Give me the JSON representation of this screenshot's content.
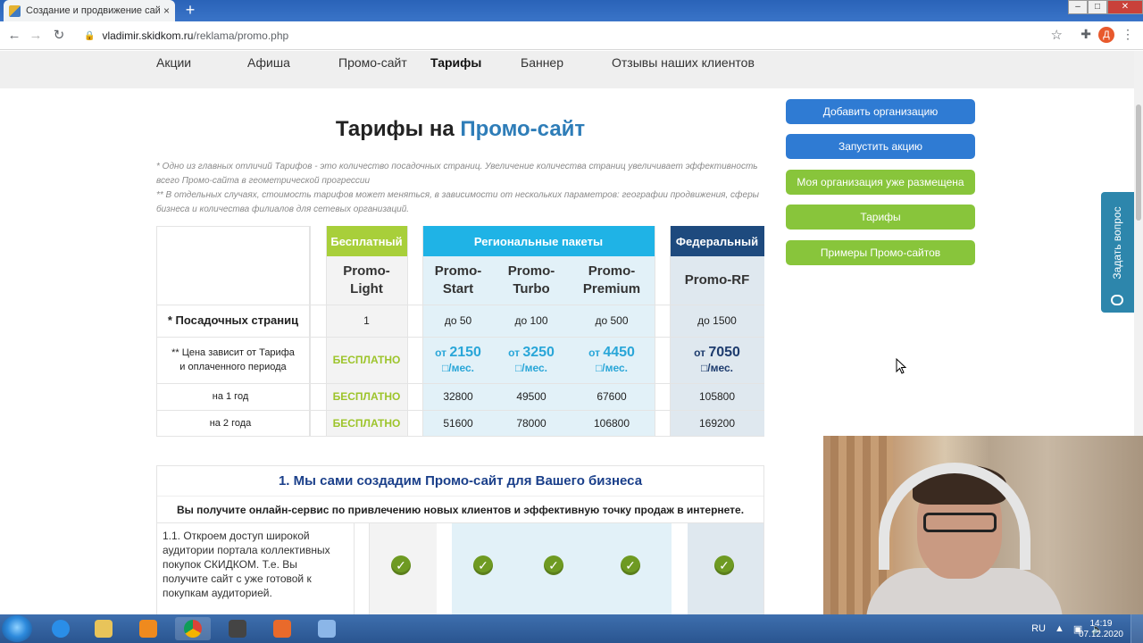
{
  "browser": {
    "tab_title": "Создание и продвижение сайт",
    "tab_close": "×",
    "new_tab": "+",
    "url_host": "vladimir.skidkom.ru",
    "url_path": "/reklama/promo.php",
    "profile_letter": "Д",
    "window_min": "–",
    "window_max": "□",
    "window_close": "✕"
  },
  "nav": {
    "items": [
      "Акции",
      "Афиша",
      "Промо-сайт",
      "Тарифы",
      "Баннер",
      "Отзывы наших клиентов"
    ],
    "active": "Тарифы"
  },
  "page": {
    "title_main": "Тарифы на ",
    "title_accent": "Промо-сайт",
    "note1": "* Одно из главных отличий Тарифов - это количество посадочных страниц. Увеличение количества страниц увеличивает эффективность всего Промо-сайта в геометрической прогрессии",
    "note2": "** В отдельных случаях, стоимость тарифов может меняться, в зависимости от нескольких параметров: географии продвижения, сферы бизнеса и количества филиалов для сетевых организаций."
  },
  "pricing": {
    "group_free": "Бесплатный",
    "group_regional": "Региональные пакеты",
    "group_federal": "Федеральный",
    "plans": [
      "Promo-\nLight",
      "Promo-\nStart",
      "Promo-\nTurbo",
      "Promo-\nPremium",
      "Promo-RF"
    ],
    "row_pages_label": "* Посадочных страниц",
    "row_pages": [
      "1",
      "до 50",
      "до 100",
      "до 500",
      "до 1500"
    ],
    "row_price_label": "** Цена зависит от Тарифа\nи оплаченного периода",
    "free_text": "БЕСПЛАТНО",
    "price_prefix": "от",
    "price_suffix": "□/мес.",
    "monthly": [
      "2150",
      "3250",
      "4450",
      "7050"
    ],
    "row_year1_label": "на 1 год",
    "year1": [
      "32800",
      "49500",
      "67600",
      "105800"
    ],
    "row_year2_label": "на 2 года",
    "year2": [
      "51600",
      "78000",
      "106800",
      "169200"
    ]
  },
  "features": {
    "title": "1. Мы сами создадим Промо-сайт для Вашего бизнеса",
    "subtitle": "Вы получите онлайн-сервис по привлечению новых клиентов и эффективную точку продаж в интернете.",
    "item1": "1.1. Откроем доступ широкой аудитории портала коллективных покупок СКИДКОМ. Т.е. Вы получите сайт с уже готовой к покупкам аудиторией."
  },
  "sidebar": {
    "buttons": [
      "Добавить организацию",
      "Запустить акцию",
      "Моя организация уже размещена",
      "Тарифы",
      "Примеры Промо-сайтов"
    ]
  },
  "ask_tab": "Задать вопрос",
  "taskbar": {
    "lang": "RU",
    "time": "14:19",
    "date": "07.12.2020"
  },
  "colors": {
    "free": "#a8cf3a",
    "regional": "#1fb3e6",
    "federal": "#1e4a7e",
    "btn_blue": "#2f7bd3",
    "btn_green": "#88c53b"
  }
}
